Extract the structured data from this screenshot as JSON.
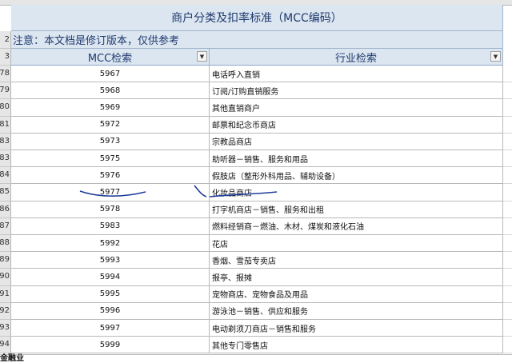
{
  "title": "商户分类及扣率标准（MCC编码）",
  "notice": "注意：本文档是修订版本，仅供参考",
  "headers": {
    "code": "MCC检索",
    "industry": "行业检索"
  },
  "header_row_labels": [
    "2",
    "3"
  ],
  "rows": [
    {
      "row": "78",
      "code": "5967",
      "industry": "电话呼入直销"
    },
    {
      "row": "79",
      "code": "5968",
      "industry": "订阅/订购直销服务"
    },
    {
      "row": "80",
      "code": "5969",
      "industry": "其他直销商户"
    },
    {
      "row": "81",
      "code": "5972",
      "industry": "邮票和纪念币商店"
    },
    {
      "row": "83",
      "code": "5973",
      "industry": "宗教品商店"
    },
    {
      "row": "83",
      "code": "5975",
      "industry": "助听器－销售、服务和用品"
    },
    {
      "row": "84",
      "code": "5976",
      "industry": "假肢店（整形外科用品、辅助设备）"
    },
    {
      "row": "85",
      "code": "5977",
      "industry": "化妆品商店"
    },
    {
      "row": "86",
      "code": "5978",
      "industry": "打字机商店－销售、服务和出租"
    },
    {
      "row": "87",
      "code": "5983",
      "industry": "燃料经销商－燃油、木材、煤炭和液化石油"
    },
    {
      "row": "88",
      "code": "5992",
      "industry": "花店"
    },
    {
      "row": "89",
      "code": "5993",
      "industry": "香烟、雪茄专卖店"
    },
    {
      "row": "90",
      "code": "5994",
      "industry": "报亭、报摊"
    },
    {
      "row": "91",
      "code": "5995",
      "industry": "宠物商店、宠物食品及用品"
    },
    {
      "row": "92",
      "code": "5996",
      "industry": "游泳池－销售、供应和服务"
    },
    {
      "row": "93",
      "code": "5997",
      "industry": "电动剃须刀商店－销售和服务"
    },
    {
      "row": "94",
      "code": "5999",
      "industry": "其他专门零售店"
    }
  ],
  "bottom_label": "金融业",
  "icons": {
    "dropdown": "dropdown-arrow-icon"
  },
  "colors": {
    "header_bg": "#dce6f1",
    "header_text": "#1f3a6e",
    "ink": "#1e3c9a"
  }
}
